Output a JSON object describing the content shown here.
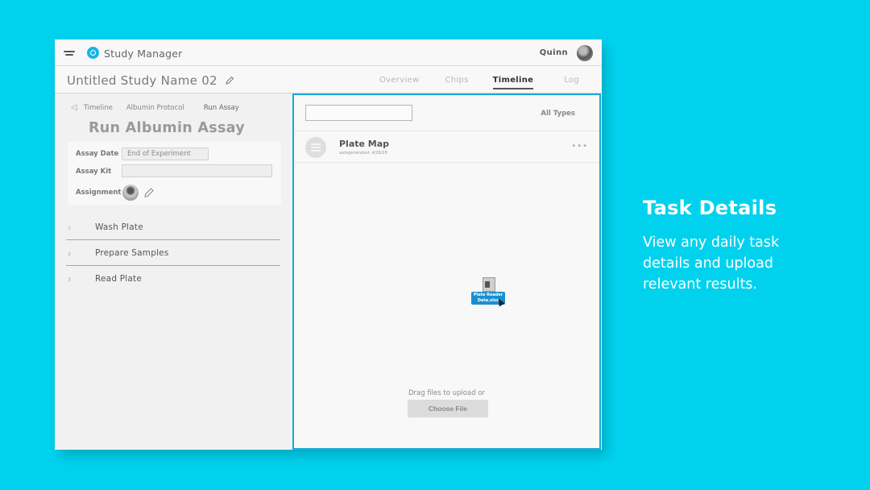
{
  "app": {
    "title": "Study Manager",
    "user": "Quinn",
    "menu_icon": "hamburger-icon",
    "logo_icon": "app-logo-icon"
  },
  "study": {
    "title": "Untitled Study Name 02",
    "tabs": [
      {
        "label": "Overview",
        "active": false
      },
      {
        "label": "Chips",
        "active": false
      },
      {
        "label": "Timeline",
        "active": true
      },
      {
        "label": "Log",
        "active": false
      }
    ]
  },
  "task": {
    "breadcrumb": [
      "Timeline",
      "Albumin Protocol",
      "Run Assay"
    ],
    "title": "Run Albumin Assay",
    "fields": {
      "assay_date_label": "Assay Date",
      "assay_date_value": "End of Experiment",
      "assay_kit_label": "Assay Kit",
      "assay_kit_value": "",
      "assignment_label": "Assignment"
    },
    "steps": [
      {
        "num": "1",
        "label": "Wash Plate"
      },
      {
        "num": "2",
        "label": "Prepare Samples"
      },
      {
        "num": "3",
        "label": "Read Plate"
      }
    ]
  },
  "files": {
    "search_value": "",
    "type_filter": "All Types",
    "items": [
      {
        "name": "Plate Map",
        "meta": "autogenerated: 4/28/18",
        "icon": "grid-icon"
      }
    ],
    "dragging_file_label": "Plate Reader Data.xlsx",
    "drop_text": "Drag files to upload or",
    "choose_button": "Choose File"
  },
  "aside": {
    "title": "Task Details",
    "description": "View any daily task details and upload relevant results."
  },
  "colors": {
    "background": "#00d2ee",
    "accent": "#1aa8d8",
    "drag_label": "#1a8fd0"
  }
}
